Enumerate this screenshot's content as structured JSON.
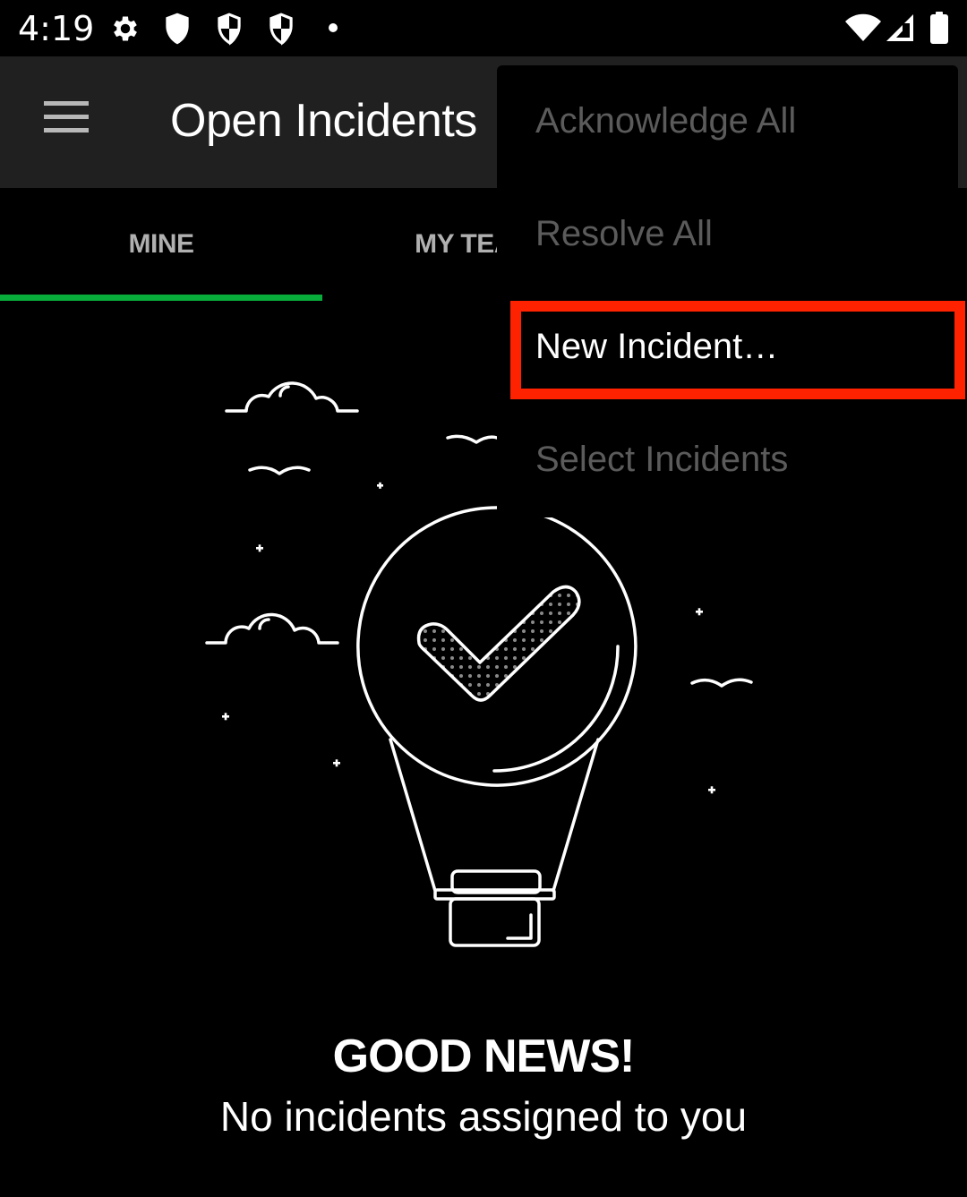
{
  "status_bar": {
    "time": "4:19",
    "left_icons": [
      "settings-gear-icon",
      "shield-icon",
      "vpn-shield-icon",
      "vpn-shield-icon",
      "notification-dot-icon"
    ],
    "right_icons": [
      "wifi-icon",
      "cellular-signal-icon",
      "battery-icon"
    ]
  },
  "app_bar": {
    "menu_icon": "hamburger-menu-icon",
    "title": "Open Incidents"
  },
  "tabs": [
    {
      "label": "MINE",
      "selected": true
    },
    {
      "label": "MY TEAMS",
      "selected": false
    }
  ],
  "colors": {
    "accent_tab_indicator": "#08ac3b",
    "highlight": "#ff2200",
    "app_bar_bg": "#202020",
    "disabled_menu_text": "#5b5b5b"
  },
  "overflow_menu": {
    "items": [
      {
        "label": "Acknowledge All",
        "enabled": false
      },
      {
        "label": "Resolve All",
        "enabled": false
      },
      {
        "label": "New Incident…",
        "enabled": true,
        "highlighted": true
      },
      {
        "label": "Select Incidents",
        "enabled": false
      }
    ]
  },
  "empty_state": {
    "illustration": "hot-air-balloon-checkmark-illustration",
    "title": "GOOD NEWS!",
    "subtitle": "No incidents assigned to you"
  }
}
